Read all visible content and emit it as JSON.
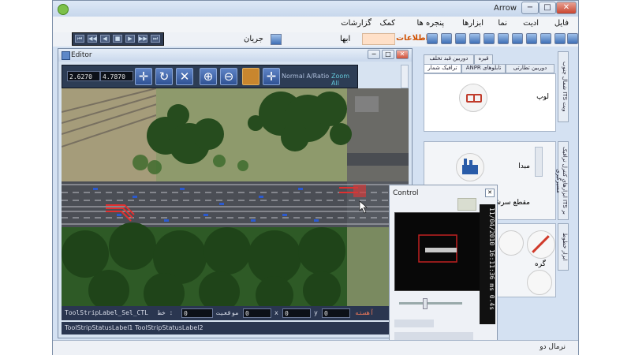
{
  "window": {
    "title": "Arrow",
    "buttons": {
      "minimize": "−",
      "maximize": "□",
      "close": "✕"
    }
  },
  "menu": [
    "فایل",
    "ادیت",
    "نما",
    "ابزارها",
    "پنجره ها",
    "کمک",
    "گزارشات"
  ],
  "toolbar": {
    "info_label": "اطلاعات",
    "abha_label": "ابها",
    "flow_label": "جریان"
  },
  "playback": [
    "⏮",
    "◀◀",
    "◀",
    "■",
    "▶",
    "▶▶",
    "⏭"
  ],
  "editor": {
    "title": "Editor",
    "coord_x": "2.6270",
    "coord_y": "4.7870",
    "tools": [
      {
        "name": "pan-tool",
        "glyph": "✛"
      },
      {
        "name": "rotate-tool",
        "glyph": "↻"
      },
      {
        "name": "delete-tool",
        "glyph": "✕"
      },
      {
        "name": "zoom-in-tool",
        "glyph": "⊕"
      },
      {
        "name": "zoom-out-tool",
        "glyph": "⊖"
      },
      {
        "name": "color-tool",
        "glyph": ""
      },
      {
        "name": "move-tool",
        "glyph": "✛"
      }
    ],
    "aspect_label": "Normal A/Ratio",
    "zoom_all_label": "Zoom All",
    "status": {
      "sel_label": "ToolStripLabel_Sel_CTL",
      "sel_suffix": "خط :",
      "value1": "0",
      "position_label": "موقعیت",
      "value2": "0",
      "x_label": "x",
      "value3": "0",
      "y_label": "y",
      "value4": "0",
      "speed_label": "آهسته"
    },
    "footer": "ToolStripStatusLabel1  ToolStripStatusLabel2"
  },
  "right_panel": {
    "top_tabs": [
      "دوربین قبد تخلف",
      "قیره",
      "دوربین تطارتی",
      "ANPR تابلوهای",
      "ترافیک شمار"
    ],
    "side_tabs": [
      "شمال چنوب ITS ویت",
      "ابزارهای کنترل ترافیک ITS بر مسیرگیری",
      "ابزار خطوط"
    ],
    "item1_label": "لوپ",
    "item2_label": "مبدا",
    "item3_label": "مقطع سرشگی",
    "item4_label": "گره"
  },
  "control_window": {
    "title": "Control",
    "date_text": "11/04/2010 16:11:36 ms 0.4s"
  },
  "main_status": "نرمال دو",
  "colors": {
    "accent": "#2d3d55",
    "info_orange": "#d05000"
  }
}
